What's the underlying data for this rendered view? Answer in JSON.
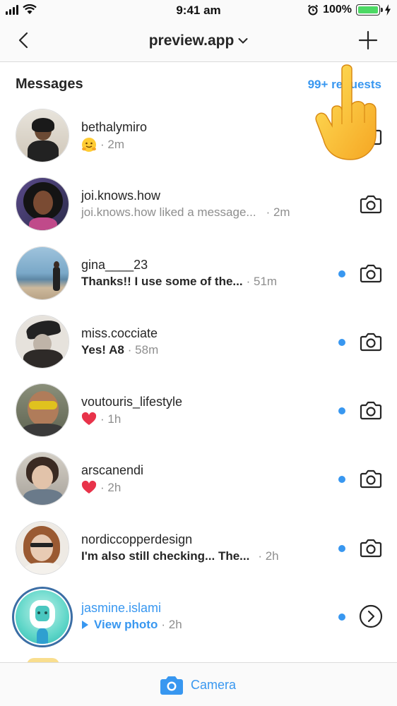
{
  "status_bar": {
    "time": "9:41 am",
    "battery_percent": "100%"
  },
  "nav": {
    "title": "preview.app",
    "back_icon": "chevron-left-icon",
    "new_message_icon": "plus-icon"
  },
  "section": {
    "title": "Messages",
    "requests_link": "99+ requests"
  },
  "threads": [
    {
      "username": "bethalymiro",
      "preview": "",
      "emoji": "hugging-face",
      "time": "· 2m",
      "unread": false,
      "action": "camera-icon"
    },
    {
      "username": "joi.knows.how",
      "preview": "joi.knows.how liked a message...",
      "time": "· 2m",
      "unread": false,
      "action": "camera-icon"
    },
    {
      "username": "gina____23",
      "preview": "Thanks!! I use some of the...",
      "time": "· 51m",
      "unread": true,
      "action": "camera-icon"
    },
    {
      "username": "miss.cocciate",
      "preview": "Yes! A8",
      "time": "· 58m",
      "unread": true,
      "action": "camera-icon"
    },
    {
      "username": "voutouris_lifestyle",
      "preview": "",
      "emoji": "red-heart",
      "time": "· 1h",
      "unread": true,
      "action": "camera-icon"
    },
    {
      "username": "arscanendi",
      "preview": "",
      "emoji": "red-heart",
      "time": "· 2h",
      "unread": true,
      "action": "camera-icon"
    },
    {
      "username": "nordiccopperdesign",
      "preview": "I'm also still checking... The...",
      "time": "· 2h",
      "unread": true,
      "action": "camera-icon"
    },
    {
      "username": "jasmine.islami",
      "preview": "View photo",
      "time": "· 2h",
      "unread": true,
      "action": "chevron-right-circle-icon"
    }
  ],
  "bottom_bar": {
    "camera_label": "Camera"
  },
  "colors": {
    "accent": "#3897f0",
    "text": "#262626",
    "muted": "#8e8e8e"
  }
}
